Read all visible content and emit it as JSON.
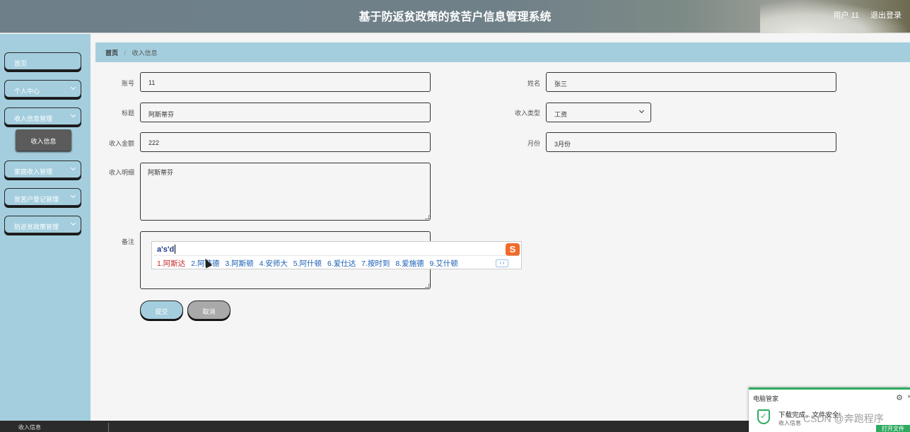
{
  "header": {
    "title": "基于防返贫政策的贫苦户信息管理系统",
    "user": "用户 11",
    "logout": "退出登录"
  },
  "sidebar": {
    "items": [
      {
        "label": "首页"
      },
      {
        "label": "个人中心"
      },
      {
        "label": "收入信息管理"
      },
      {
        "label": "家庭收入管理"
      },
      {
        "label": "贫苦户登记管理"
      },
      {
        "label": "防返贫政策管理"
      }
    ],
    "submenu": {
      "label": "收入信息"
    }
  },
  "breadcrumb": {
    "home": "首页",
    "separator": "/",
    "current": "收入信息"
  },
  "form": {
    "account": {
      "label": "账号",
      "value": "11"
    },
    "name": {
      "label": "姓名",
      "value": "张三"
    },
    "title": {
      "label": "标题",
      "value": "阿斯蒂芬"
    },
    "income_type": {
      "label": "收入类型",
      "value": "工资"
    },
    "amount": {
      "label": "收入金额",
      "value": "222"
    },
    "month": {
      "label": "月份",
      "value": "3月份"
    },
    "detail": {
      "label": "收入明细",
      "value": "阿斯蒂芬"
    },
    "remark": {
      "label": "备注",
      "value": ""
    },
    "submit": "提交",
    "cancel": "取消"
  },
  "ime": {
    "composition": "a's'd",
    "candidates": [
      "1.阿斯达",
      "2.阿萨德",
      "3.阿斯顿",
      "4.安师大",
      "5.阿什顿",
      "6.爱仕达",
      "7.按时到",
      "8.爱施德",
      "9.艾什顿"
    ],
    "logo": "S",
    "pager": "‹ ›"
  },
  "taskbar": {
    "label": "收入信息"
  },
  "toast": {
    "app": "电脑管家",
    "message": "下载完成，文件安全!",
    "sub": "收入信息",
    "action": "打开文件"
  },
  "watermark": "CSDN @奔跑程序",
  "colors": {
    "sidebar": "#a4cede",
    "submit_button": "#a4cede",
    "cancel_button": "#a9a9a9",
    "active_submenu": "#5b5b5b",
    "toast_accent": "#2eaa62"
  }
}
